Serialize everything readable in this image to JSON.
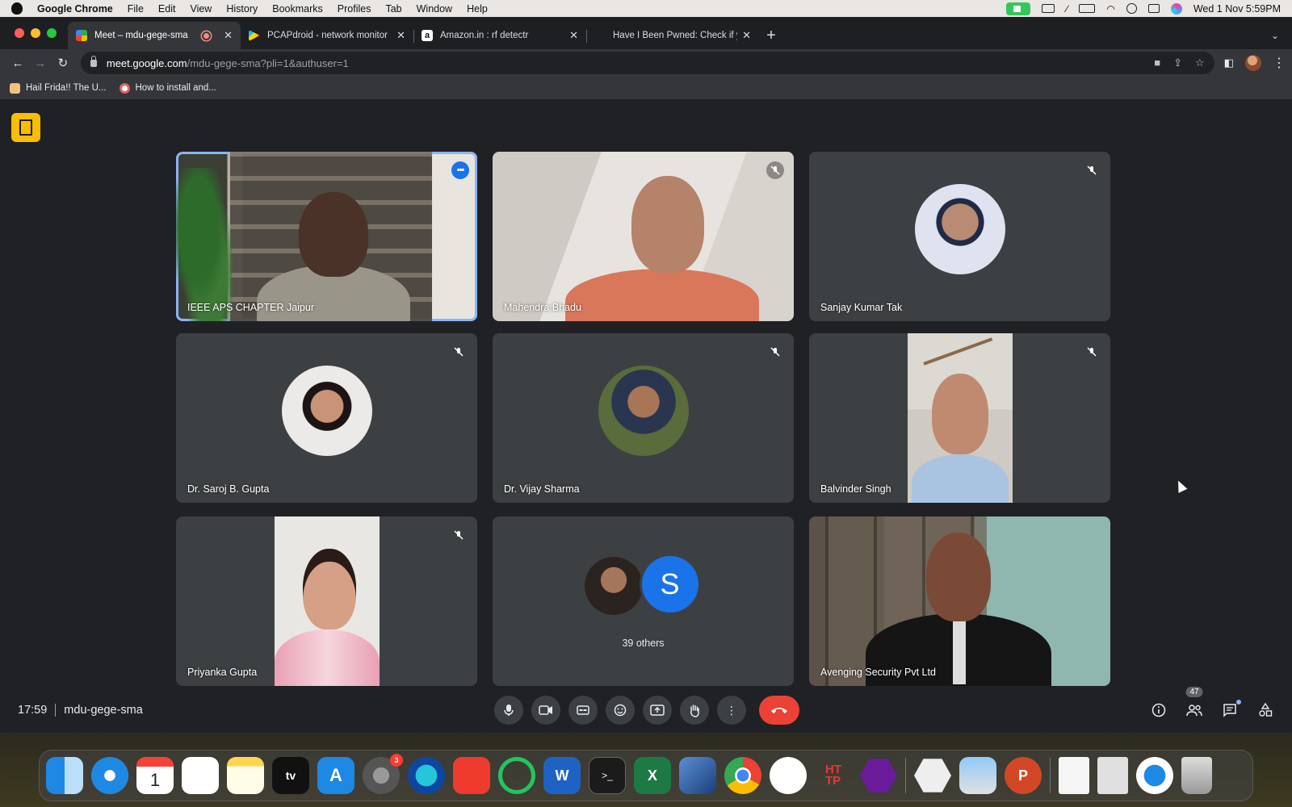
{
  "menubar": {
    "app_name": "Google Chrome",
    "items": [
      "File",
      "Edit",
      "View",
      "History",
      "Bookmarks",
      "Profiles",
      "Tab",
      "Window",
      "Help"
    ],
    "clock": "Wed 1 Nov  5:59PM"
  },
  "tabs": [
    {
      "title": "Meet – mdu-gege-sma",
      "active": true,
      "recording": true
    },
    {
      "title": "PCAPdroid - network monitor",
      "active": false
    },
    {
      "title": "Amazon.in : rf detectr",
      "active": false
    },
    {
      "title": "Have I Been Pwned: Check if y",
      "active": false
    }
  ],
  "address": {
    "host": "meet.google.com",
    "path": "/mdu-gege-sma?pli=1&authuser=1"
  },
  "bookmarks": [
    "Hail Frida!! The U...",
    "How to install and..."
  ],
  "participants": [
    {
      "name": "IEEE APS CHAPTER Jaipur",
      "kind": "video",
      "active": true
    },
    {
      "name": "Mahendra Bhadu",
      "kind": "video",
      "muted": true
    },
    {
      "name": "Sanjay Kumar Tak",
      "kind": "avatar",
      "muted": true
    },
    {
      "name": "Dr. Saroj B. Gupta",
      "kind": "avatar",
      "muted": true
    },
    {
      "name": "Dr. Vijay Sharma",
      "kind": "avatar",
      "muted": true
    },
    {
      "name": "Balvinder Singh",
      "kind": "video",
      "muted": true
    },
    {
      "name": "Priyanka Gupta",
      "kind": "video",
      "muted": true
    },
    {
      "name": "Avenging Security Pvt Ltd",
      "kind": "video"
    }
  ],
  "others": {
    "initial": "S",
    "label": "39 others"
  },
  "meeting": {
    "time": "17:59",
    "code": "mdu-gege-sma"
  },
  "people_count": "47",
  "colors": {
    "accent": "#8ab4f8",
    "end_call": "#ea4335",
    "meet_logo": "#fbbc04",
    "avatar_blue": "#1a73e8"
  },
  "dock": {
    "settings_badge": "3"
  }
}
